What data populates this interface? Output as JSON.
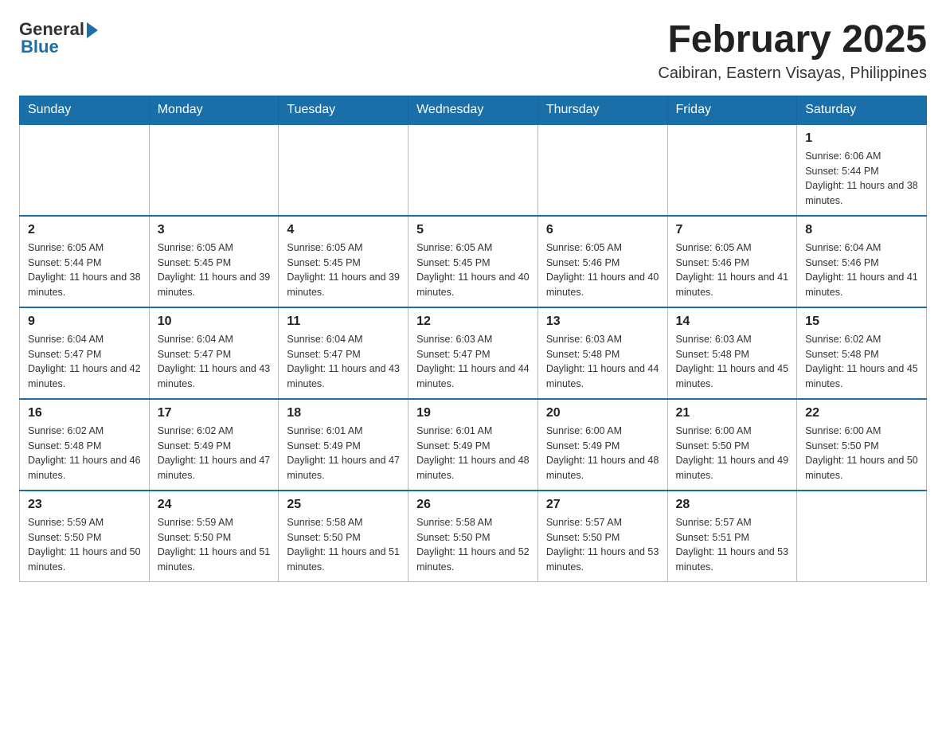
{
  "header": {
    "logo_general": "General",
    "logo_blue": "Blue",
    "month_title": "February 2025",
    "location": "Caibiran, Eastern Visayas, Philippines"
  },
  "weekdays": [
    "Sunday",
    "Monday",
    "Tuesday",
    "Wednesday",
    "Thursday",
    "Friday",
    "Saturday"
  ],
  "weeks": [
    [
      {
        "day": "",
        "info": ""
      },
      {
        "day": "",
        "info": ""
      },
      {
        "day": "",
        "info": ""
      },
      {
        "day": "",
        "info": ""
      },
      {
        "day": "",
        "info": ""
      },
      {
        "day": "",
        "info": ""
      },
      {
        "day": "1",
        "info": "Sunrise: 6:06 AM\nSunset: 5:44 PM\nDaylight: 11 hours and 38 minutes."
      }
    ],
    [
      {
        "day": "2",
        "info": "Sunrise: 6:05 AM\nSunset: 5:44 PM\nDaylight: 11 hours and 38 minutes."
      },
      {
        "day": "3",
        "info": "Sunrise: 6:05 AM\nSunset: 5:45 PM\nDaylight: 11 hours and 39 minutes."
      },
      {
        "day": "4",
        "info": "Sunrise: 6:05 AM\nSunset: 5:45 PM\nDaylight: 11 hours and 39 minutes."
      },
      {
        "day": "5",
        "info": "Sunrise: 6:05 AM\nSunset: 5:45 PM\nDaylight: 11 hours and 40 minutes."
      },
      {
        "day": "6",
        "info": "Sunrise: 6:05 AM\nSunset: 5:46 PM\nDaylight: 11 hours and 40 minutes."
      },
      {
        "day": "7",
        "info": "Sunrise: 6:05 AM\nSunset: 5:46 PM\nDaylight: 11 hours and 41 minutes."
      },
      {
        "day": "8",
        "info": "Sunrise: 6:04 AM\nSunset: 5:46 PM\nDaylight: 11 hours and 41 minutes."
      }
    ],
    [
      {
        "day": "9",
        "info": "Sunrise: 6:04 AM\nSunset: 5:47 PM\nDaylight: 11 hours and 42 minutes."
      },
      {
        "day": "10",
        "info": "Sunrise: 6:04 AM\nSunset: 5:47 PM\nDaylight: 11 hours and 43 minutes."
      },
      {
        "day": "11",
        "info": "Sunrise: 6:04 AM\nSunset: 5:47 PM\nDaylight: 11 hours and 43 minutes."
      },
      {
        "day": "12",
        "info": "Sunrise: 6:03 AM\nSunset: 5:47 PM\nDaylight: 11 hours and 44 minutes."
      },
      {
        "day": "13",
        "info": "Sunrise: 6:03 AM\nSunset: 5:48 PM\nDaylight: 11 hours and 44 minutes."
      },
      {
        "day": "14",
        "info": "Sunrise: 6:03 AM\nSunset: 5:48 PM\nDaylight: 11 hours and 45 minutes."
      },
      {
        "day": "15",
        "info": "Sunrise: 6:02 AM\nSunset: 5:48 PM\nDaylight: 11 hours and 45 minutes."
      }
    ],
    [
      {
        "day": "16",
        "info": "Sunrise: 6:02 AM\nSunset: 5:48 PM\nDaylight: 11 hours and 46 minutes."
      },
      {
        "day": "17",
        "info": "Sunrise: 6:02 AM\nSunset: 5:49 PM\nDaylight: 11 hours and 47 minutes."
      },
      {
        "day": "18",
        "info": "Sunrise: 6:01 AM\nSunset: 5:49 PM\nDaylight: 11 hours and 47 minutes."
      },
      {
        "day": "19",
        "info": "Sunrise: 6:01 AM\nSunset: 5:49 PM\nDaylight: 11 hours and 48 minutes."
      },
      {
        "day": "20",
        "info": "Sunrise: 6:00 AM\nSunset: 5:49 PM\nDaylight: 11 hours and 48 minutes."
      },
      {
        "day": "21",
        "info": "Sunrise: 6:00 AM\nSunset: 5:50 PM\nDaylight: 11 hours and 49 minutes."
      },
      {
        "day": "22",
        "info": "Sunrise: 6:00 AM\nSunset: 5:50 PM\nDaylight: 11 hours and 50 minutes."
      }
    ],
    [
      {
        "day": "23",
        "info": "Sunrise: 5:59 AM\nSunset: 5:50 PM\nDaylight: 11 hours and 50 minutes."
      },
      {
        "day": "24",
        "info": "Sunrise: 5:59 AM\nSunset: 5:50 PM\nDaylight: 11 hours and 51 minutes."
      },
      {
        "day": "25",
        "info": "Sunrise: 5:58 AM\nSunset: 5:50 PM\nDaylight: 11 hours and 51 minutes."
      },
      {
        "day": "26",
        "info": "Sunrise: 5:58 AM\nSunset: 5:50 PM\nDaylight: 11 hours and 52 minutes."
      },
      {
        "day": "27",
        "info": "Sunrise: 5:57 AM\nSunset: 5:50 PM\nDaylight: 11 hours and 53 minutes."
      },
      {
        "day": "28",
        "info": "Sunrise: 5:57 AM\nSunset: 5:51 PM\nDaylight: 11 hours and 53 minutes."
      },
      {
        "day": "",
        "info": ""
      }
    ]
  ]
}
